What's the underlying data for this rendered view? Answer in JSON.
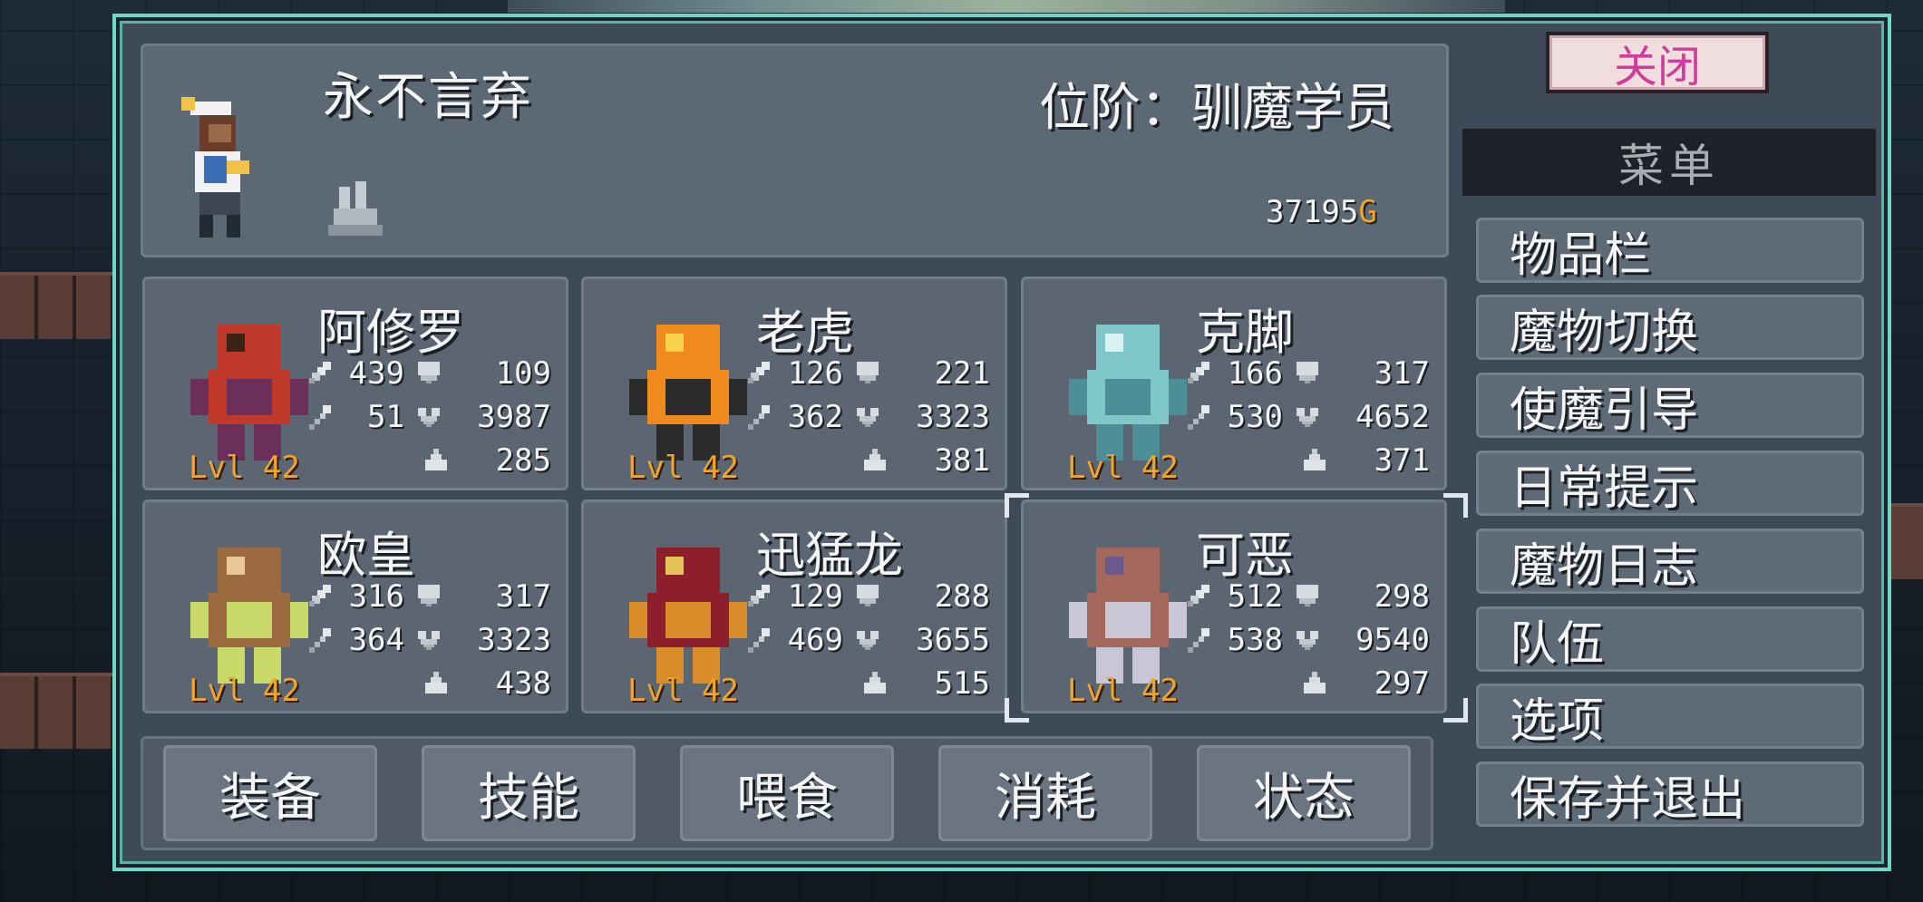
{
  "player": {
    "name": "永不言弃",
    "rank_label": "位阶：",
    "rank_value": "驯魔学员",
    "gold_amount": "37195",
    "gold_symbol": "G"
  },
  "monsters": [
    {
      "name": "阿修罗",
      "attack": "439",
      "defense": "109",
      "magic": "51",
      "health": "3987",
      "mana": "285",
      "level": "Lvl 42"
    },
    {
      "name": "老虎",
      "attack": "126",
      "defense": "221",
      "magic": "362",
      "health": "3323",
      "mana": "381",
      "level": "Lvl 42"
    },
    {
      "name": "克脚",
      "attack": "166",
      "defense": "317",
      "magic": "530",
      "health": "4652",
      "mana": "371",
      "level": "Lvl 42"
    },
    {
      "name": "欧皇",
      "attack": "316",
      "defense": "317",
      "magic": "364",
      "health": "3323",
      "mana": "438",
      "level": "Lvl 42"
    },
    {
      "name": "迅猛龙",
      "attack": "129",
      "defense": "288",
      "magic": "469",
      "health": "3655",
      "mana": "515",
      "level": "Lvl 42"
    },
    {
      "name": "可恶",
      "attack": "512",
      "defense": "298",
      "magic": "538",
      "health": "9540",
      "mana": "297",
      "level": "Lvl 42"
    }
  ],
  "actions": [
    "装备",
    "技能",
    "喂食",
    "消耗",
    "状态"
  ],
  "menu": {
    "close_label": "关闭",
    "title": "菜单",
    "items": [
      "物品栏",
      "魔物切换",
      "使魔引导",
      "日常提示",
      "魔物日志",
      "队伍",
      "选项",
      "保存并退出"
    ]
  },
  "colors": {
    "frame_accent": "#6fd8c4",
    "level_text": "#f0a526",
    "gold_symbol": "#f0a526",
    "close_text": "#d23a9b"
  },
  "icons": {
    "attack": "sword-icon",
    "defense": "shield-icon",
    "magic": "wand-icon",
    "health": "heart-icon",
    "mana": "pouch-icon",
    "player_item": "boot-icon"
  }
}
